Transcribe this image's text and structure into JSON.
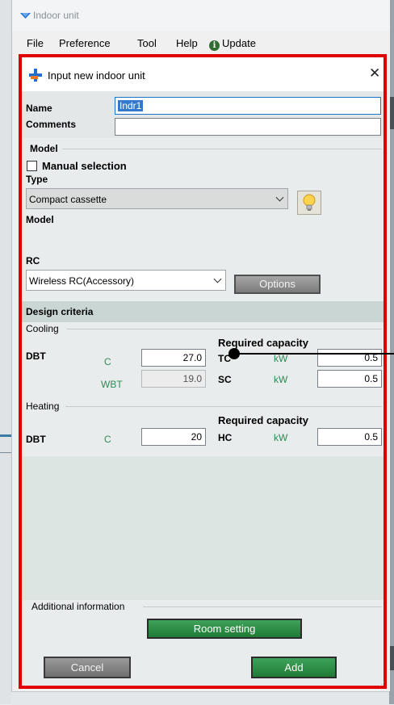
{
  "window": {
    "title": "Indoor unit"
  },
  "menu": {
    "items": [
      "File",
      "Preference",
      "Tool",
      "Help",
      "Update"
    ]
  },
  "dialog": {
    "title": "Input new indoor unit",
    "close_glyph": "✕",
    "name_label": "Name",
    "name_value": "Indr1",
    "comments_label": "Comments",
    "comments_value": ""
  },
  "model": {
    "section_label": "Model",
    "manual_selection_label": "Manual selection",
    "manual_selection_checked": false,
    "type_label": "Type",
    "type_value": "Compact cassette",
    "model_label": "Model",
    "model_value": "",
    "rc_label": "RC",
    "rc_value": "Wireless RC(Accessory)",
    "options_button": "Options"
  },
  "design": {
    "title": "Design criteria",
    "cooling": {
      "group": "Cooling",
      "required_capacity": "Required capacity",
      "dbt_label": "DBT",
      "dbt_unit": "C",
      "dbt_value": "27.0",
      "wbt_unit": "WBT",
      "wbt_value": "19.0",
      "tc_label": "TC",
      "tc_unit": "kW",
      "tc_value": "0.5",
      "sc_label": "SC",
      "sc_unit": "kW",
      "sc_value": "0.5"
    },
    "heating": {
      "group": "Heating",
      "required_capacity": "Required capacity",
      "dbt_label": "DBT",
      "dbt_unit": "C",
      "dbt_value": "20",
      "hc_label": "HC",
      "hc_unit": "kW",
      "hc_value": "0.5"
    }
  },
  "additional": {
    "group": "Additional information",
    "room_setting_button": "Room setting"
  },
  "footer": {
    "cancel_button": "Cancel",
    "add_button": "Add"
  },
  "colors": {
    "highlight_border": "#e00000",
    "unit_text": "#2e8b57",
    "green_button": "#2e8f47"
  }
}
